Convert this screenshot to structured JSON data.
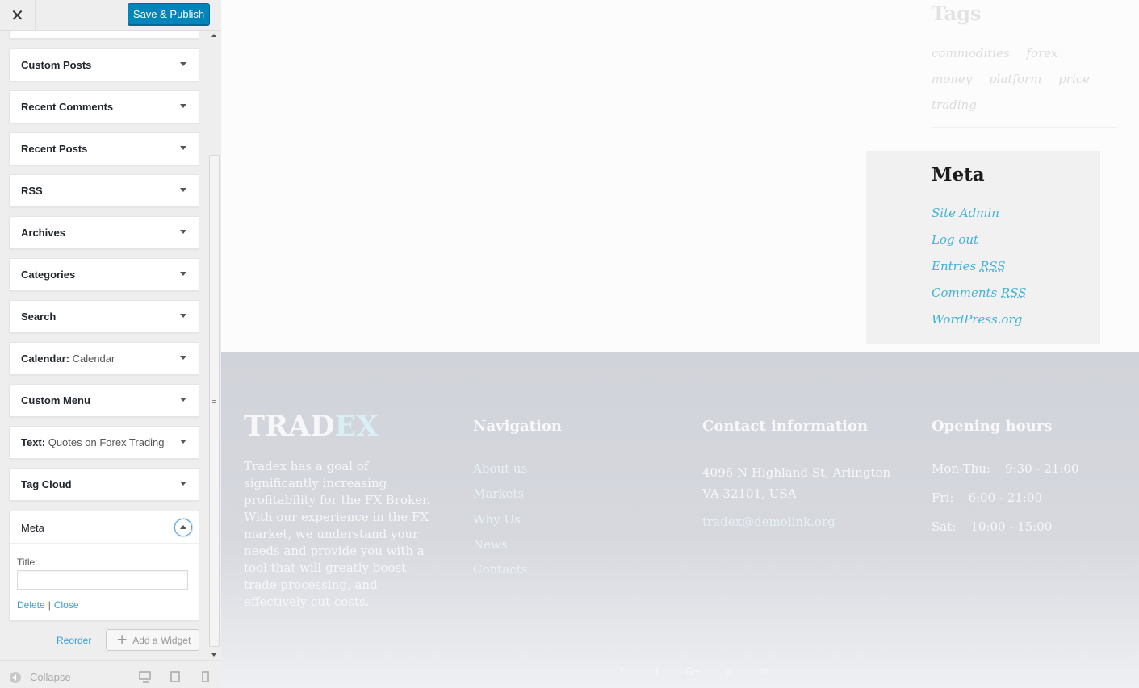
{
  "topbar": {
    "close_label": "✕",
    "save_label": "Save & Publish"
  },
  "widgets": [
    {
      "title": "Custom Posts",
      "subtitle": ""
    },
    {
      "title": "Recent Comments",
      "subtitle": ""
    },
    {
      "title": "Recent Posts",
      "subtitle": ""
    },
    {
      "title": "RSS",
      "subtitle": ""
    },
    {
      "title": "Archives",
      "subtitle": ""
    },
    {
      "title": "Categories",
      "subtitle": ""
    },
    {
      "title": "Search",
      "subtitle": ""
    },
    {
      "title": "Calendar",
      "subtitle": "Calendar"
    },
    {
      "title": "Custom Menu",
      "subtitle": ""
    },
    {
      "title": "Text",
      "subtitle": "Quotes on Forex Trading"
    },
    {
      "title": "Tag Cloud",
      "subtitle": ""
    }
  ],
  "meta_widget": {
    "title": "Meta",
    "field_label": "Title:",
    "field_value": "",
    "delete_label": "Delete",
    "separator": "|",
    "close_label": "Close"
  },
  "actions": {
    "reorder_label": "Reorder",
    "add_widget_label": "Add a Widget",
    "add_widget_icon": "+"
  },
  "footer_bar": {
    "collapse_label": "Collapse"
  },
  "preview": {
    "tags": {
      "heading": "Tags",
      "items": [
        "commodities",
        "forex",
        "money",
        "platform",
        "price",
        "trading"
      ]
    },
    "meta": {
      "heading": "Meta",
      "links": [
        {
          "text": "Site Admin",
          "rss": ""
        },
        {
          "text": "Log out",
          "rss": ""
        },
        {
          "text": "Entries ",
          "rss": "RSS"
        },
        {
          "text": "Comments ",
          "rss": "RSS"
        },
        {
          "text": "WordPress.org",
          "rss": ""
        }
      ]
    },
    "footer": {
      "logo_part1": "TRAD",
      "logo_part2": "EX",
      "about": "Tradex has a goal of significantly increasing profitability for the FX Broker. With our experience in the FX market, we understand your needs and provide you with a tool that will greatly boost trade processing, and effectively cut costs.",
      "navigation": {
        "heading": "Navigation",
        "links": [
          "About us",
          "Markets",
          "Why Us",
          "News",
          "Contacts"
        ]
      },
      "contact": {
        "heading": "Contact information",
        "address_line1": "4096 N Highland St, Arlington",
        "address_line2": "VA 32101, USA",
        "email": "tradex@demolink.org"
      },
      "hours": {
        "heading": "Opening hours",
        "rows": [
          {
            "day": "Mon-Thu:",
            "time": "9:30 - 21:00"
          },
          {
            "day": "Fri:",
            "time": "6:00 - 21:00"
          },
          {
            "day": "Sat:",
            "time": "10:00 - 15:00"
          }
        ]
      },
      "social": [
        {
          "icon": "facebook-icon",
          "glyph": "f"
        },
        {
          "icon": "twitter-icon",
          "glyph": "t"
        },
        {
          "icon": "google-plus-icon",
          "glyph": "G+"
        },
        {
          "icon": "pinterest-icon",
          "glyph": "p"
        },
        {
          "icon": "linkedin-icon",
          "glyph": "in"
        }
      ]
    }
  }
}
